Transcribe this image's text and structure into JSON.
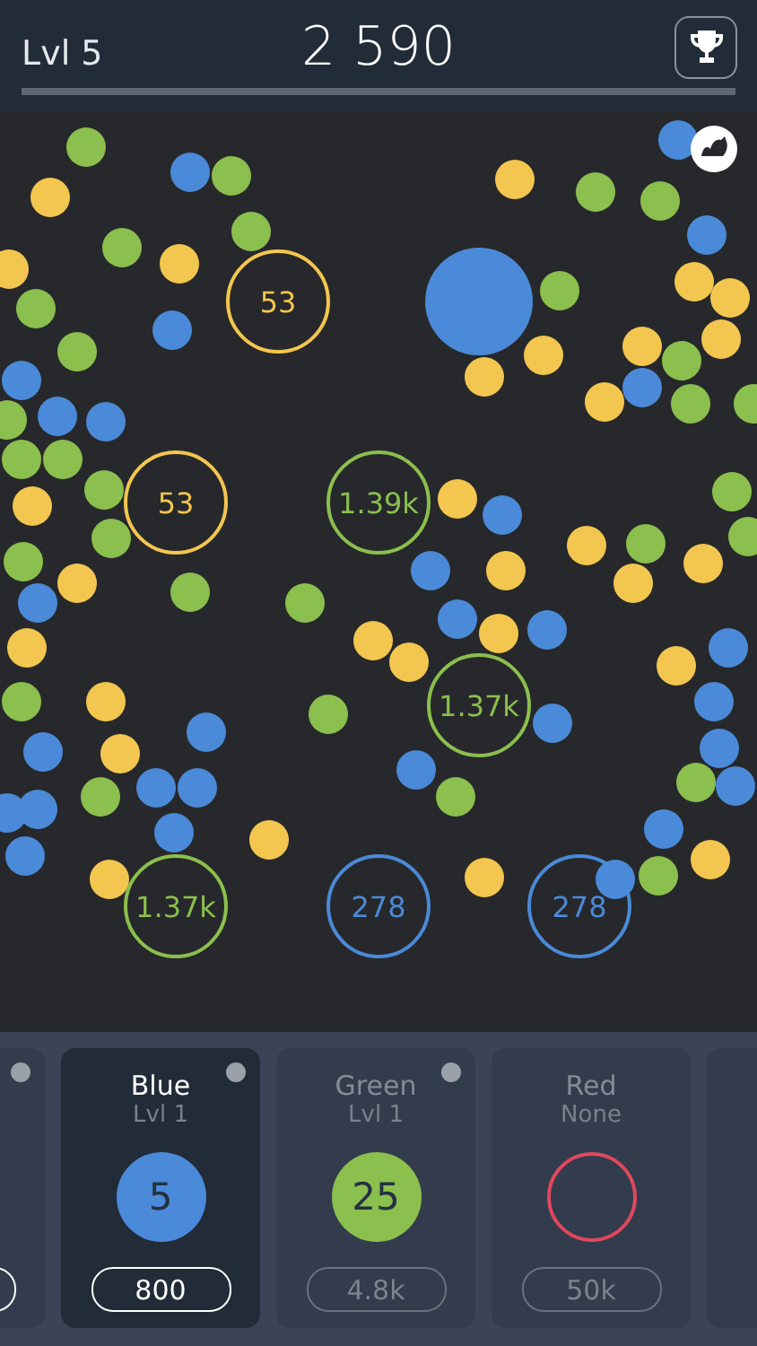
{
  "header": {
    "level_label": "Lvl 5",
    "score": "2 590"
  },
  "rings": [
    {
      "value": "53",
      "color": "#f3c64f"
    },
    {
      "value": "53",
      "color": "#f3c64f"
    },
    {
      "value": "1.39k",
      "color": "#8bbf4e"
    },
    {
      "value": "1.37k",
      "color": "#8bbf4e"
    },
    {
      "value": "1.37k",
      "color": "#8bbf4e"
    },
    {
      "value": "278",
      "color": "#4a8ad8"
    },
    {
      "value": "278",
      "color": "#4a8ad8"
    }
  ],
  "cards": [
    {
      "kind": "cut",
      "dot": true,
      "selected": false
    },
    {
      "kind": "full",
      "name": "Blue",
      "subtitle": "Lvl 1",
      "value": "5",
      "color": "#4a8ad8",
      "price": "800",
      "dot": true,
      "selected": true
    },
    {
      "kind": "full",
      "name": "Green",
      "subtitle": "Lvl 1",
      "value": "25",
      "color": "#8bbf4e",
      "price": "4.8k",
      "dot": true,
      "selected": false
    },
    {
      "kind": "full",
      "name": "Red",
      "subtitle": "None",
      "color": "#e0485e",
      "price": "50k",
      "dot": false,
      "selected": false
    },
    {
      "kind": "cut",
      "selected": false
    }
  ]
}
